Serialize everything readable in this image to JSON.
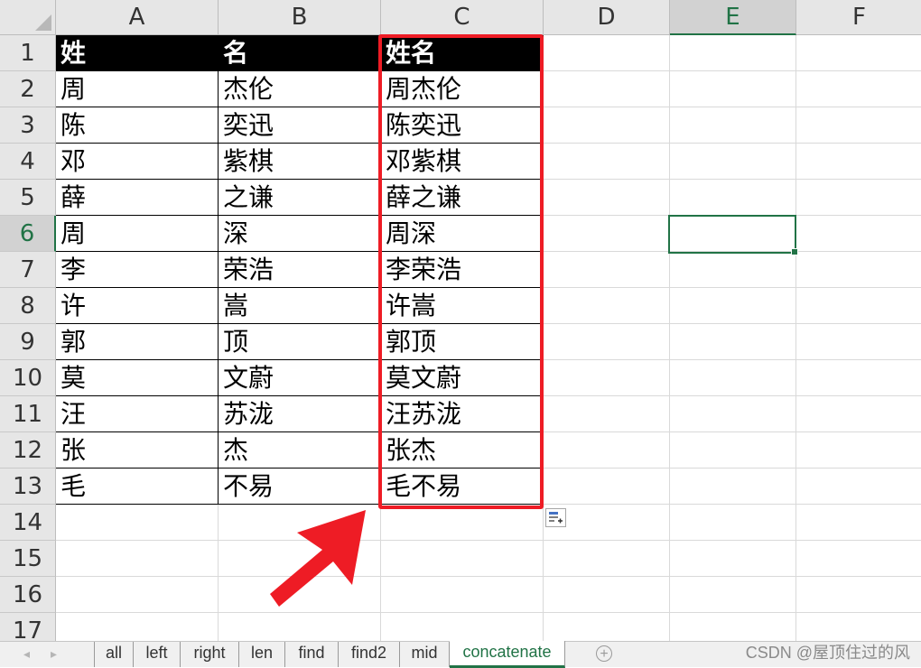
{
  "columns": [
    "A",
    "B",
    "C",
    "D",
    "E",
    "F"
  ],
  "active_column": "E",
  "rows": [
    "1",
    "2",
    "3",
    "4",
    "5",
    "6",
    "7",
    "8",
    "9",
    "10",
    "11",
    "12",
    "13",
    "14",
    "15",
    "16",
    "17"
  ],
  "active_row": "6",
  "table": {
    "header": [
      "姓",
      "名",
      "姓名"
    ],
    "data": [
      [
        "周",
        "杰伦",
        "周杰伦"
      ],
      [
        "陈",
        "奕迅",
        "陈奕迅"
      ],
      [
        "邓",
        "紫棋",
        "邓紫棋"
      ],
      [
        "薛",
        "之谦",
        "薛之谦"
      ],
      [
        "周",
        "深",
        "周深"
      ],
      [
        "李",
        "荣浩",
        "李荣浩"
      ],
      [
        "许",
        "嵩",
        "许嵩"
      ],
      [
        "郭",
        "顶",
        "郭顶"
      ],
      [
        "莫",
        "文蔚",
        "莫文蔚"
      ],
      [
        "汪",
        "苏泷",
        "汪苏泷"
      ],
      [
        "张",
        "杰",
        "张杰"
      ],
      [
        "毛",
        "不易",
        "毛不易"
      ]
    ]
  },
  "sheet_tabs": [
    "all",
    "left",
    "right",
    "len",
    "find",
    "find2",
    "mid",
    "concatenate"
  ],
  "active_tab": "concatenate",
  "nav_prev": "◂",
  "nav_next": "▸",
  "add_sheet": "+",
  "watermark": "CSDN @屋顶住过的风",
  "colors": {
    "accent": "#217346",
    "highlight": "#ee1c25",
    "header_bg": "#000000"
  }
}
